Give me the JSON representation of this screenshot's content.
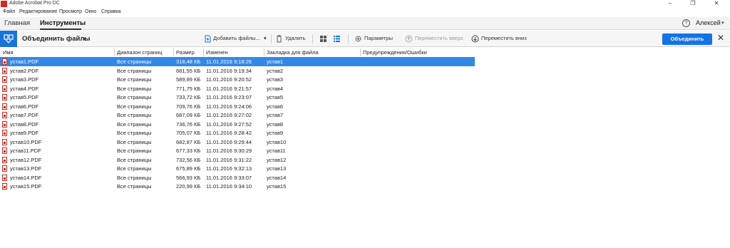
{
  "window": {
    "title": "Adobe Acrobat Pro DC",
    "minimize": "–",
    "restore": "❐",
    "close": "✕"
  },
  "menu": [
    "Файл",
    "Редактирование",
    "Просмотр",
    "Окно",
    "Справка"
  ],
  "tabs": {
    "home": "Главная",
    "tools": "Инструменты",
    "active": "tools"
  },
  "account": {
    "help": "?",
    "user": "Алексей",
    "caret": "▾"
  },
  "toolbar": {
    "title": "Объединить файлы",
    "title_caret": "▾",
    "add_files": "Добавить файлы...",
    "add_caret": "▾",
    "delete": "Удалить",
    "options": "Параметры",
    "move_up": "Переместить вверх",
    "move_down": "Переместить вниз",
    "combine": "Объединить",
    "close": "✕"
  },
  "colors": {
    "accent": "#1473e6",
    "selection": "#3388e6",
    "pdf_red": "#c8281e"
  },
  "table": {
    "columns": [
      "Имя",
      "Диапазон страниц",
      "Размер",
      "Изменен",
      "Закладка для файла",
      "Предупреждения/Ошибки"
    ],
    "selected_index": 0,
    "rows": [
      {
        "name": "устав1.PDF",
        "range": "Все страницы",
        "size": "318,48 КБ",
        "modified": "11.01.2016 9:18:26",
        "bookmark": "устав1"
      },
      {
        "name": "устав2.PDF",
        "range": "Все страницы",
        "size": "681,55 КБ",
        "modified": "11.01.2016 9:19:34",
        "bookmark": "устав2"
      },
      {
        "name": "устав3.PDF",
        "range": "Все страницы",
        "size": "589,89 КБ",
        "modified": "11.01.2016 9:20:52",
        "bookmark": "устав3"
      },
      {
        "name": "устав4.PDF",
        "range": "Все страницы",
        "size": "771,75 КБ",
        "modified": "11.01.2016 9:21:57",
        "bookmark": "устав4"
      },
      {
        "name": "устав5.PDF",
        "range": "Все страницы",
        "size": "733,72 КБ",
        "modified": "11.01.2016 9:23:07",
        "bookmark": "устав5"
      },
      {
        "name": "устав6.PDF",
        "range": "Все страницы",
        "size": "709,76 КБ",
        "modified": "11.01.2016 9:24:06",
        "bookmark": "устав6"
      },
      {
        "name": "устав7.PDF",
        "range": "Все страницы",
        "size": "687,09 КБ",
        "modified": "11.01.2016 9:27:02",
        "bookmark": "устав7"
      },
      {
        "name": "устав8.PDF",
        "range": "Все страницы",
        "size": "736,76 КБ",
        "modified": "11.01.2016 9:27:52",
        "bookmark": "устав8"
      },
      {
        "name": "устав9.PDF",
        "range": "Все страницы",
        "size": "705,07 КБ",
        "modified": "11.01.2016 9:28:42",
        "bookmark": "устав9"
      },
      {
        "name": "устав10.PDF",
        "range": "Все страницы",
        "size": "682,87 КБ",
        "modified": "11.01.2016 9:29:44",
        "bookmark": "устав10"
      },
      {
        "name": "устав11.PDF",
        "range": "Все страницы",
        "size": "677,33 КБ",
        "modified": "11.01.2016 9:30:29",
        "bookmark": "устав11"
      },
      {
        "name": "устав12.PDF",
        "range": "Все страницы",
        "size": "732,56 КБ",
        "modified": "11.01.2016 9:31:22",
        "bookmark": "устав12"
      },
      {
        "name": "устав13.PDF",
        "range": "Все страницы",
        "size": "675,89 КБ",
        "modified": "11.01.2016 9:32:13",
        "bookmark": "устав13"
      },
      {
        "name": "устав14.PDF",
        "range": "Все страницы",
        "size": "566,93 КБ",
        "modified": "11.01.2016 9:33:07",
        "bookmark": "устав14"
      },
      {
        "name": "устав15.PDF",
        "range": "Все страницы",
        "size": "220,99 КБ",
        "modified": "11.01.2016 9:34:10",
        "bookmark": "устав15"
      }
    ]
  }
}
